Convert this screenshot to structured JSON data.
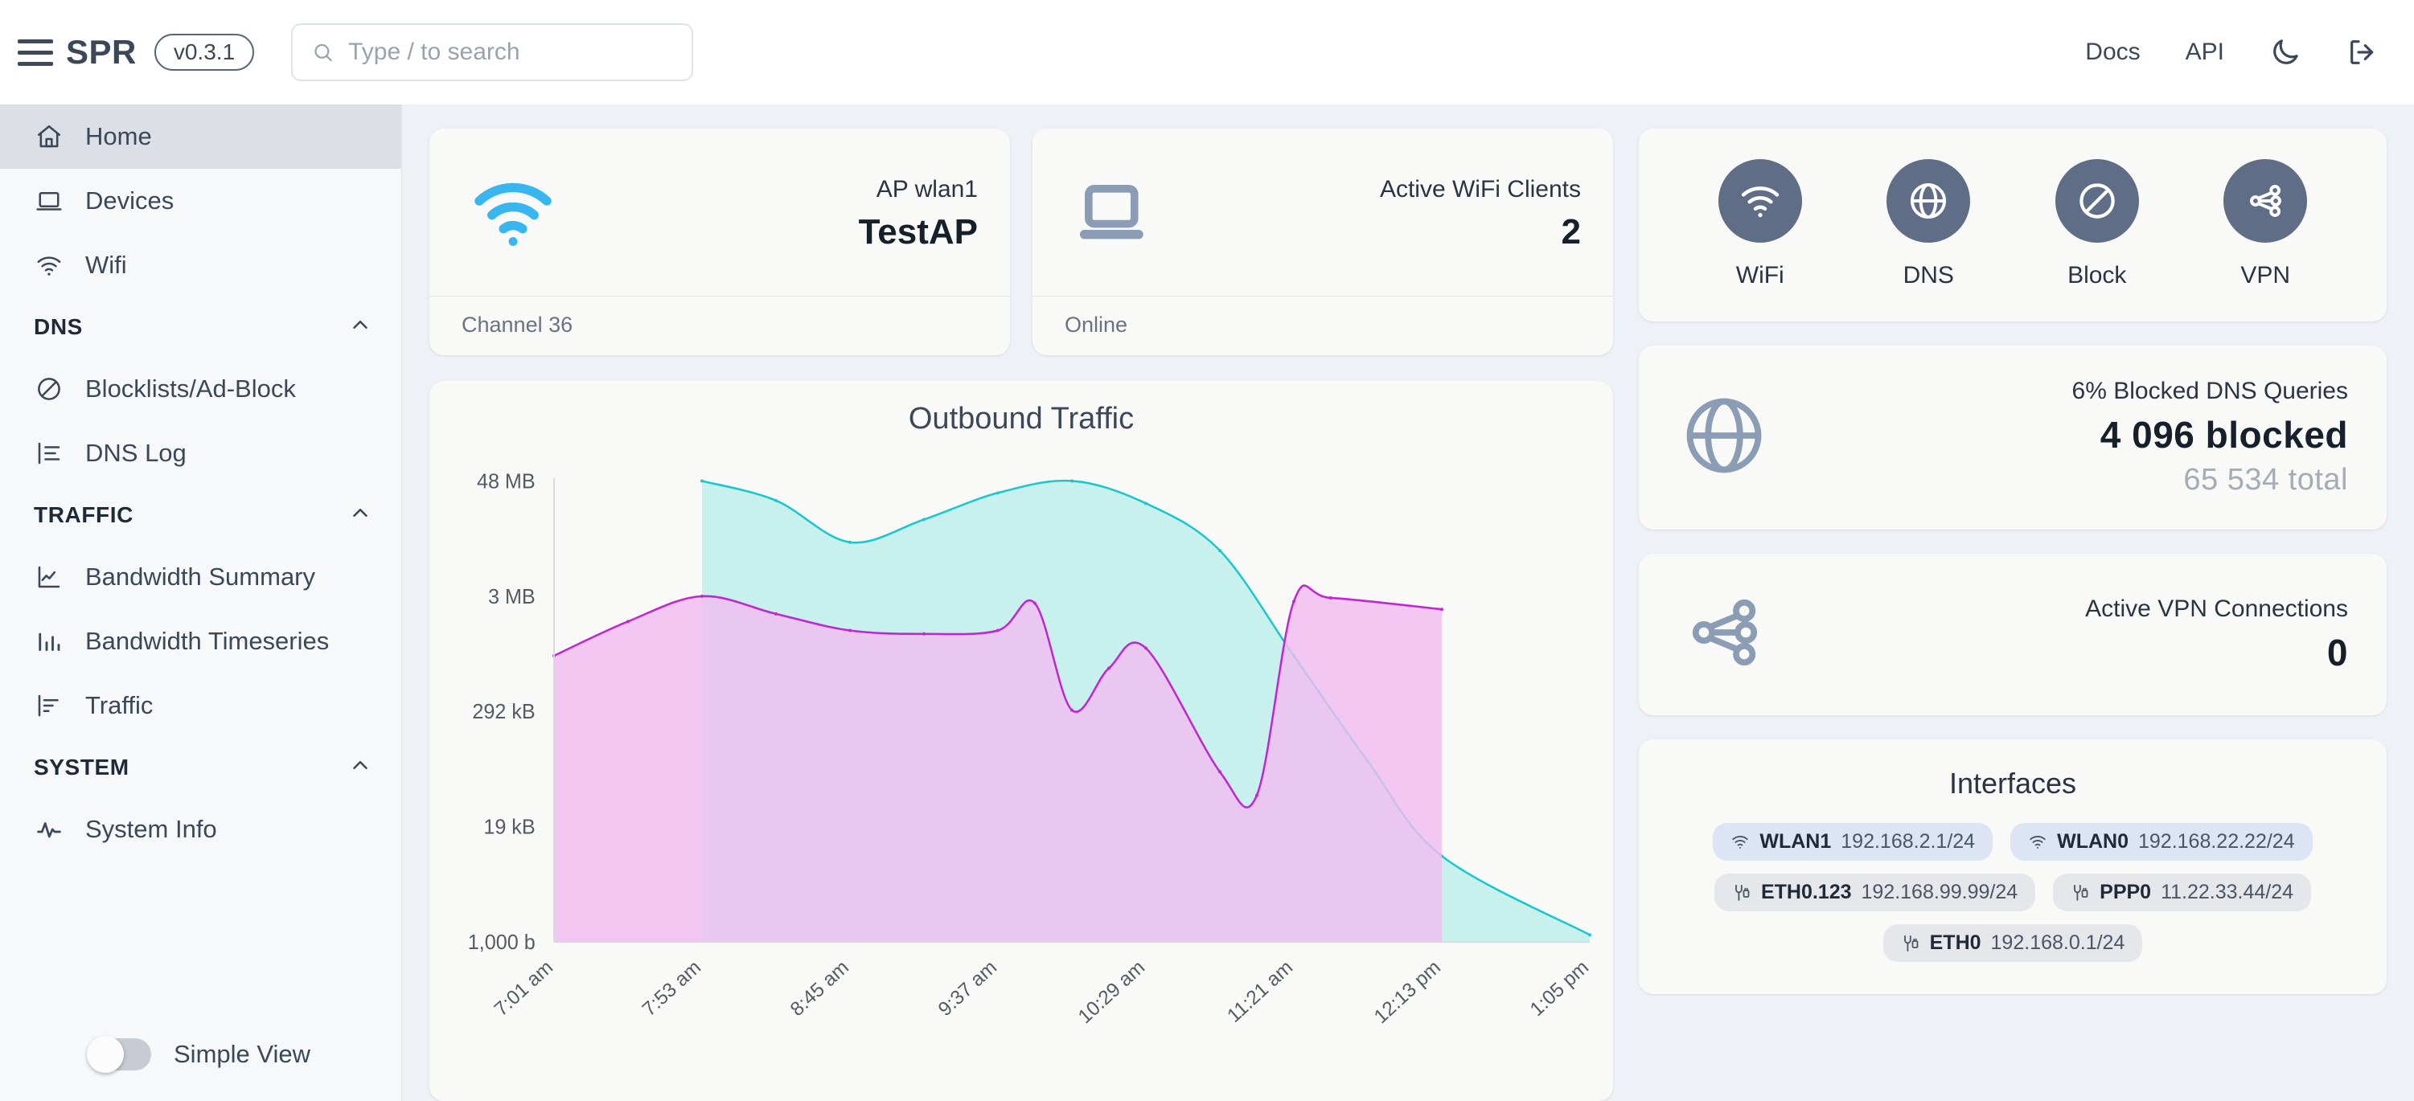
{
  "header": {
    "brand": "SPR",
    "version": "v0.3.1",
    "search_placeholder": "Type / to search",
    "search_value": "",
    "links": [
      {
        "label": "Docs",
        "name": "docs-link"
      },
      {
        "label": "API",
        "name": "api-link"
      }
    ],
    "dark_mode_icon": "moon-icon",
    "logout_icon": "logout-icon",
    "menu_icon": "hamburger-menu-icon",
    "search_icon": "search-icon"
  },
  "sidebar": {
    "items": [
      {
        "label": "Home",
        "icon": "home-icon",
        "active": true
      },
      {
        "label": "Devices",
        "icon": "laptop-icon",
        "active": false
      },
      {
        "label": "Wifi",
        "icon": "wifi-icon",
        "active": false
      }
    ],
    "sections": [
      {
        "title": "DNS",
        "items": [
          {
            "label": "Blocklists/Ad-Block",
            "icon": "block-icon"
          },
          {
            "label": "DNS Log",
            "icon": "list-tree-icon"
          }
        ]
      },
      {
        "title": "TRAFFIC",
        "items": [
          {
            "label": "Bandwidth Summary",
            "icon": "line-chart-icon"
          },
          {
            "label": "Bandwidth Timeseries",
            "icon": "bar-chart-icon"
          },
          {
            "label": "Traffic",
            "icon": "bar-list-icon"
          }
        ]
      },
      {
        "title": "SYSTEM",
        "items": [
          {
            "label": "System Info",
            "icon": "activity-icon"
          }
        ]
      }
    ],
    "simple_view_label": "Simple View",
    "simple_view_on": false
  },
  "stats": {
    "ap": {
      "label": "AP wlan1",
      "value": "TestAP",
      "footer": "Channel 36",
      "icon": "wifi-icon",
      "icon_color": "#38b6f0"
    },
    "clients": {
      "label": "Active WiFi Clients",
      "value": "2",
      "footer": "Online",
      "icon": "laptop-icon",
      "icon_color": "#8b9cb5"
    }
  },
  "quick_actions": {
    "items": [
      {
        "label": "WiFi",
        "icon": "wifi-icon"
      },
      {
        "label": "DNS",
        "icon": "globe-icon"
      },
      {
        "label": "Block",
        "icon": "block-icon"
      },
      {
        "label": "VPN",
        "icon": "vpn-network-icon"
      }
    ],
    "circle_color": "#5f6e86"
  },
  "dns_card": {
    "label": "6% Blocked DNS Queries",
    "value": "4 096 blocked",
    "total": "65 534 total",
    "icon": "globe-icon",
    "icon_color": "#8b9cb5"
  },
  "vpn_card": {
    "label": "Active VPN Connections",
    "value": "0",
    "icon": "vpn-network-icon",
    "icon_color": "#8b9cb5"
  },
  "interfaces": {
    "title": "Interfaces",
    "rows": [
      [
        {
          "name": "WLAN1",
          "addr": "192.168.2.1/24",
          "icon": "wifi-icon",
          "style": "blue"
        },
        {
          "name": "WLAN0",
          "addr": "192.168.22.22/24",
          "icon": "wifi-icon",
          "style": "blue"
        }
      ],
      [
        {
          "name": "ETH0.123",
          "addr": "192.168.99.99/24",
          "icon": "plug-icon",
          "style": "grey"
        },
        {
          "name": "PPP0",
          "addr": "11.22.33.44/24",
          "icon": "plug-icon",
          "style": "grey"
        }
      ],
      [
        {
          "name": "ETH0",
          "addr": "192.168.0.1/24",
          "icon": "plug-icon",
          "style": "grey"
        }
      ]
    ]
  },
  "chart_data": {
    "type": "area",
    "title": "Outbound Traffic",
    "xlabel": "",
    "ylabel": "",
    "grid": false,
    "legend": "none",
    "y_scale": "log",
    "y_ticks": [
      "48 MB",
      "3 MB",
      "292 kB",
      "19 kB",
      "1,000 b"
    ],
    "y_tick_values": [
      48000000,
      3000000,
      292000,
      19000,
      1000
    ],
    "x": [
      "7:01 am",
      "7:53 am",
      "8:45 am",
      "9:37 am",
      "10:29 am",
      "11:21 am",
      "12:13 pm",
      "1:05 pm"
    ],
    "x_tick_labels": [
      "7:01 am",
      "7:53 am",
      "8:45 am",
      "9:37 am",
      "10:29 am",
      "11:21 am",
      "12:13 pm",
      "1:05 pm"
    ],
    "series": [
      {
        "name": "series-teal",
        "color": "#18c8cc",
        "fill": "#bdeeea",
        "points": [
          {
            "t": "7:53 am",
            "v": 48000000
          },
          {
            "t": "8:19 am",
            "v": 30000000
          },
          {
            "t": "8:45 am",
            "v": 11000000
          },
          {
            "t": "9:11 am",
            "v": 19000000
          },
          {
            "t": "9:37 am",
            "v": 36000000
          },
          {
            "t": "10:03 am",
            "v": 52000000
          },
          {
            "t": "10:29 am",
            "v": 28000000
          },
          {
            "t": "10:55 am",
            "v": 9000000
          },
          {
            "t": "11:21 am",
            "v": 900000
          },
          {
            "t": "11:47 am",
            "v": 90000
          },
          {
            "t": "12:13 pm",
            "v": 9000
          },
          {
            "t": "1:05 pm",
            "v": 1200
          }
        ]
      },
      {
        "name": "series-magenta",
        "color": "#c026d3",
        "fill": "#f0bdf0",
        "points": [
          {
            "t": "7:01 am",
            "v": 900000
          },
          {
            "t": "7:27 am",
            "v": 1800000
          },
          {
            "t": "7:53 am",
            "v": 3000000
          },
          {
            "t": "8:19 am",
            "v": 2100000
          },
          {
            "t": "8:45 am",
            "v": 1500000
          },
          {
            "t": "9:11 am",
            "v": 1400000
          },
          {
            "t": "9:37 am",
            "v": 1500000
          },
          {
            "t": "9:50 am",
            "v": 2600000
          },
          {
            "t": "10:03 am",
            "v": 300000
          },
          {
            "t": "10:16 am",
            "v": 700000
          },
          {
            "t": "10:29 am",
            "v": 1050000
          },
          {
            "t": "10:55 am",
            "v": 70000
          },
          {
            "t": "11:08 am",
            "v": 40000
          },
          {
            "t": "11:21 am",
            "v": 2700000
          },
          {
            "t": "11:34 am",
            "v": 2900000
          },
          {
            "t": "12:13 pm",
            "v": 2300000
          }
        ]
      }
    ]
  }
}
